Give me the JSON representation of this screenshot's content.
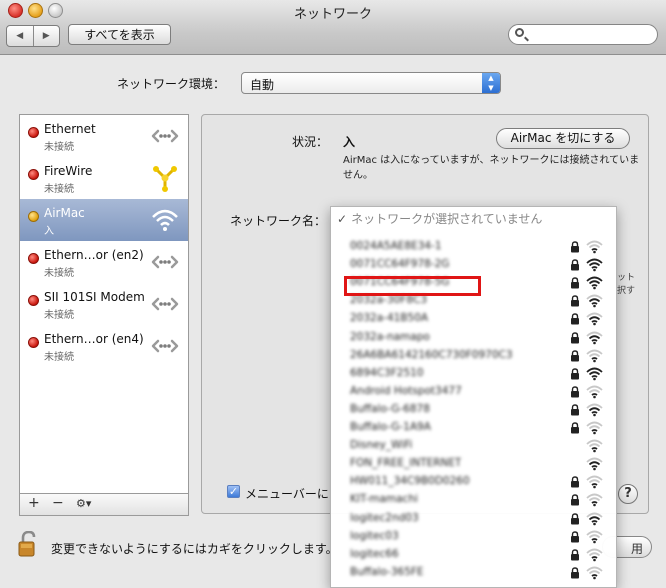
{
  "window": {
    "title": "ネットワーク"
  },
  "toolbar": {
    "back_glyph": "◀",
    "forward_glyph": "▶",
    "show_all_label": "すべてを表示",
    "search_placeholder": ""
  },
  "location": {
    "label": "ネットワーク環境：",
    "value": "自動"
  },
  "services": [
    {
      "name": "Ethernet",
      "status": "未接続",
      "dot": "red",
      "icon": "ethernet-icon"
    },
    {
      "name": "FireWire",
      "status": "未接続",
      "dot": "red",
      "icon": "firewire-icon"
    },
    {
      "name": "AirMac",
      "status": "入",
      "dot": "yellow",
      "icon": "wifi-icon",
      "selected": true
    },
    {
      "name": "Ethern…or (en2)",
      "status": "未接続",
      "dot": "red",
      "icon": "ethernet-icon"
    },
    {
      "name": "SII 101SI Modem",
      "status": "未接続",
      "dot": "red",
      "icon": "ethernet-icon"
    },
    {
      "name": "Ethern…or (en4)",
      "status": "未接続",
      "dot": "red",
      "icon": "ethernet-icon"
    }
  ],
  "sidebar_controls": {
    "add": "+",
    "remove": "−",
    "gear": "⚙▾"
  },
  "status": {
    "label": "状況：",
    "value": "入",
    "description": "AirMac は入になっていますが、ネットワークには接続されていません。",
    "toggle_button": "AirMac を切にする"
  },
  "network_name": {
    "label": "ネットワーク名：",
    "placeholder_item": "ネットワークが選択されていません",
    "networks": [
      {
        "name": "0024A5AE8E34-1",
        "locked": true,
        "signal": 1
      },
      {
        "name": "0071CC64F978-2G",
        "locked": true,
        "signal": 3
      },
      {
        "name": "0071CC64F978-5G",
        "locked": true,
        "signal": 3,
        "highlighted": true
      },
      {
        "name": "2032a-30F8C3",
        "locked": true,
        "signal": 2
      },
      {
        "name": "2032a-41B50A",
        "locked": true,
        "signal": 2
      },
      {
        "name": "2032a-namapo",
        "locked": true,
        "signal": 2
      },
      {
        "name": "26A6BA6142160C730F0970C3",
        "locked": true,
        "signal": 1
      },
      {
        "name": "6894C3F2510",
        "locked": true,
        "signal": 3
      },
      {
        "name": "Android Hotspot3477",
        "locked": true,
        "signal": 1
      },
      {
        "name": "Buffalo-G-6878",
        "locked": true,
        "signal": 2
      },
      {
        "name": "Buffalo-G-1A9A",
        "locked": true,
        "signal": 1
      },
      {
        "name": "Disney_WiFi",
        "locked": false,
        "signal": 1
      },
      {
        "name": "FON_FREE_INTERNET",
        "locked": false,
        "signal": 2
      },
      {
        "name": "HW011_34C9B0D0260",
        "locked": true,
        "signal": 1
      },
      {
        "name": "KIT-mamachi",
        "locked": true,
        "signal": 1
      },
      {
        "name": "logitec2nd03",
        "locked": true,
        "signal": 2
      },
      {
        "name": "logitec03",
        "locked": true,
        "signal": 1
      },
      {
        "name": "logitec66",
        "locked": true,
        "signal": 1
      },
      {
        "name": "Buffalo-365FE",
        "locked": true,
        "signal": 1
      }
    ]
  },
  "bg_fragments": {
    "a": "ット",
    "b": "択す"
  },
  "menubar": {
    "checked": true,
    "check_glyph": "✓",
    "label": "メニューバーに"
  },
  "help": {
    "glyph": "?"
  },
  "lock": {
    "label": "変更できないようにするにはカギをクリックします。"
  },
  "partial_button": {
    "label": "用"
  }
}
